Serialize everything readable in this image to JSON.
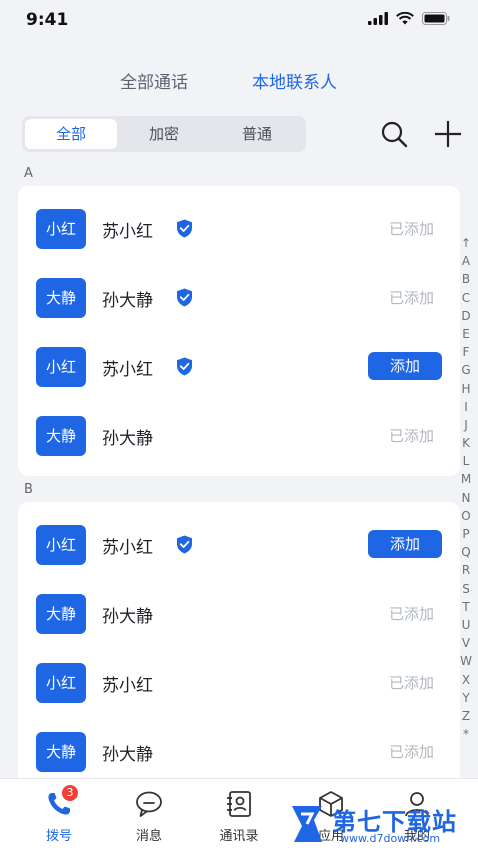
{
  "status_bar": {
    "time": "9:41"
  },
  "top_tabs": [
    {
      "label": "全部通话",
      "active": false
    },
    {
      "label": "本地联系人",
      "active": true
    }
  ],
  "filter": {
    "options": [
      "全部",
      "加密",
      "普通"
    ],
    "selected": "全部"
  },
  "sections": [
    {
      "letter": "A",
      "contacts": [
        {
          "avatar": "小红",
          "name": "苏小红",
          "verified": true,
          "status": "已添加",
          "action": null
        },
        {
          "avatar": "大静",
          "name": "孙大静",
          "verified": true,
          "status": "已添加",
          "action": null
        },
        {
          "avatar": "小红",
          "name": "苏小红",
          "verified": true,
          "status": null,
          "action": "添加"
        },
        {
          "avatar": "大静",
          "name": "孙大静",
          "verified": false,
          "status": "已添加",
          "action": null
        }
      ]
    },
    {
      "letter": "B",
      "contacts": [
        {
          "avatar": "小红",
          "name": "苏小红",
          "verified": true,
          "status": null,
          "action": "添加"
        },
        {
          "avatar": "大静",
          "name": "孙大静",
          "verified": false,
          "status": "已添加",
          "action": null
        },
        {
          "avatar": "小红",
          "name": "苏小红",
          "verified": false,
          "status": "已添加",
          "action": null
        },
        {
          "avatar": "大静",
          "name": "孙大静",
          "verified": false,
          "status": "已添加",
          "action": null
        }
      ]
    }
  ],
  "alpha_index": [
    "↑",
    "A",
    "B",
    "C",
    "D",
    "E",
    "F",
    "G",
    "H",
    "I",
    "J",
    "K",
    "L",
    "M",
    "N",
    "O",
    "P",
    "Q",
    "R",
    "S",
    "T",
    "U",
    "V",
    "W",
    "X",
    "Y",
    "Z",
    "*"
  ],
  "tab_bar": {
    "items": [
      {
        "label": "拨号",
        "icon": "phone-icon",
        "active": true,
        "badge": "3"
      },
      {
        "label": "消息",
        "icon": "message-icon",
        "active": false
      },
      {
        "label": "通讯录",
        "icon": "contacts-icon",
        "active": false
      },
      {
        "label": "应用",
        "icon": "apps-icon",
        "active": false
      },
      {
        "label": "我的",
        "icon": "profile-icon",
        "active": false
      }
    ]
  },
  "watermark": {
    "main": "第七下载站",
    "sub": "www.d7down.com"
  },
  "colors": {
    "accent": "#1f66e5",
    "muted": "#b3b8c0",
    "badge": "#f04134",
    "background": "#f2f3f7"
  }
}
